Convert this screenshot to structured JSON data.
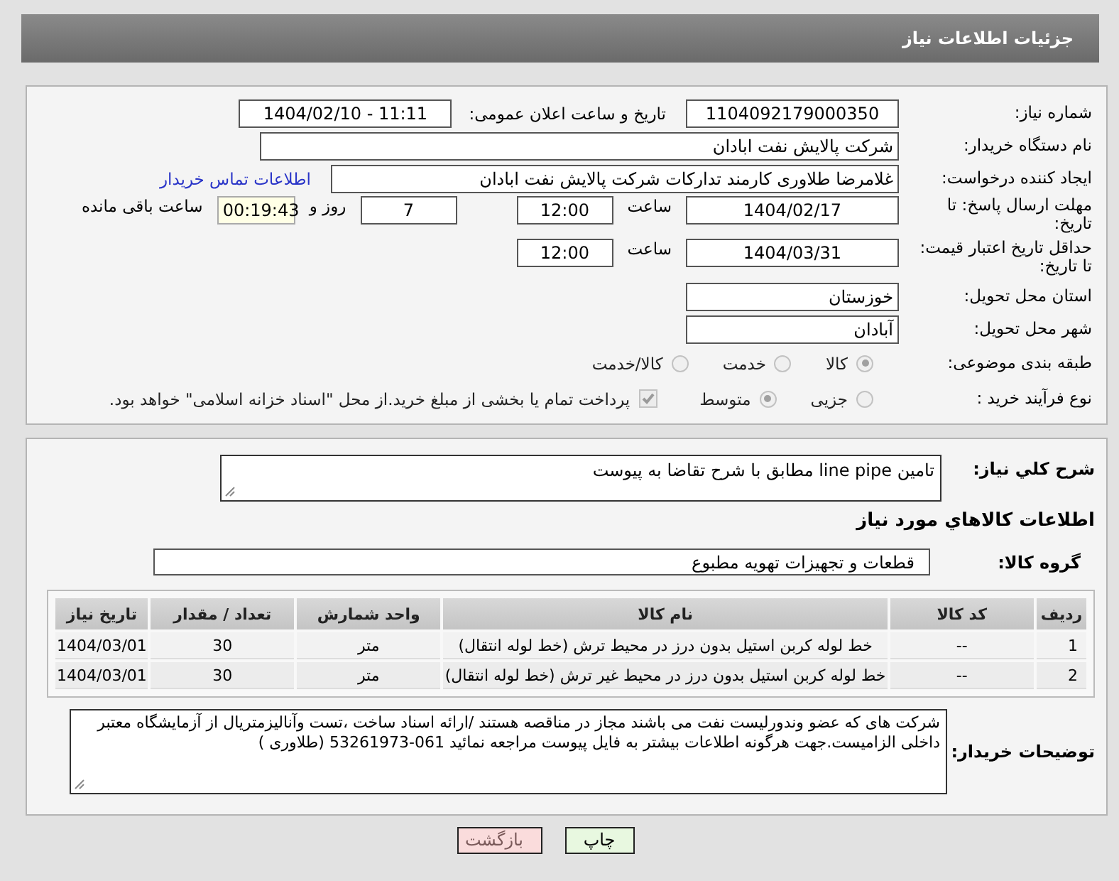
{
  "header": {
    "title": "جزئیات اطلاعات نیاز"
  },
  "need_number": {
    "label": "شماره نیاز:",
    "value": "1104092179000350"
  },
  "announce": {
    "label": "تاریخ و ساعت اعلان عمومی:",
    "value": "1404/02/10 - 11:11"
  },
  "buyer_org": {
    "label": "نام دستگاه خریدار:",
    "value": "شرکت پالایش نفت ابادان"
  },
  "requester": {
    "label": "ایجاد کننده درخواست:",
    "value": "غلامرضا طلاوری کارمند تدارکات شرکت پالایش نفت ابادان",
    "link": "اطلاعات تماس خریدار"
  },
  "reply_deadline": {
    "label": "مهلت ارسال پاسخ: تا تاریخ:",
    "date": "1404/02/17",
    "time_label": "ساعت",
    "time": "12:00",
    "days": "7",
    "days_label": "روز و",
    "remaining": "00:19:43",
    "remaining_label": "ساعت باقی مانده"
  },
  "price_validity": {
    "label": "حداقل تاریخ اعتبار قیمت: تا تاریخ:",
    "date": "1404/03/31",
    "time_label": "ساعت",
    "time": "12:00"
  },
  "province": {
    "label": "استان محل تحویل:",
    "value": "خوزستان"
  },
  "city": {
    "label": "شهر محل تحویل:",
    "value": "آبادان"
  },
  "category": {
    "label": "طبقه بندی موضوعی:",
    "options": [
      {
        "label": "کالا",
        "selected": true
      },
      {
        "label": "خدمت",
        "selected": false
      },
      {
        "label": "کالا/خدمت",
        "selected": false
      }
    ]
  },
  "process": {
    "label": "نوع فرآیند خرید :",
    "options": [
      {
        "label": "جزیی",
        "selected": false
      },
      {
        "label": "متوسط",
        "selected": true
      }
    ],
    "treasury": {
      "label": "پرداخت تمام یا بخشی از مبلغ خرید.از محل \"اسناد خزانه اسلامی\" خواهد بود.",
      "checked": true
    }
  },
  "description": {
    "label": "شرح کلي نياز:",
    "value": "تامین line pipe  مطابق با شرح تقاضا به پیوست"
  },
  "items_heading": "اطلاعات کالاهاي مورد نياز",
  "group": {
    "label": "گروه کالا:",
    "value": "قطعات و تجهیزات تهویه مطبوع"
  },
  "table": {
    "columns": [
      "ردیف",
      "کد کالا",
      "نام کالا",
      "واحد شمارش",
      "تعداد / مقدار",
      "تاریخ نیاز"
    ],
    "rows": [
      [
        "1",
        "--",
        "خط لوله کربن استیل بدون درز در محیط ترش (خط لوله انتقال)",
        "متر",
        "30",
        "1404/03/01"
      ],
      [
        "2",
        "--",
        "خط لوله کربن استیل بدون درز در محیط غیر ترش (خط لوله انتقال)",
        "متر",
        "30",
        "1404/03/01"
      ]
    ]
  },
  "buyer_notes": {
    "label": "توضیحات خریدار:",
    "value": "شرکت های که عضو وندورلیست نفت می باشند مجاز در مناقصه هستند /ارائه اسناد ساخت ،تست وآنالیزمتریال از آزمایشگاه معتبر داخلی الزامیست.جهت هرگونه اطلاعات بیشتر به فایل پیوست مراجعه نمائید  061-53261973 (طلاوری )"
  },
  "buttons": [
    {
      "label": "چاپ",
      "kind": "print"
    },
    {
      "label": "بازگشت",
      "kind": "back"
    }
  ]
}
